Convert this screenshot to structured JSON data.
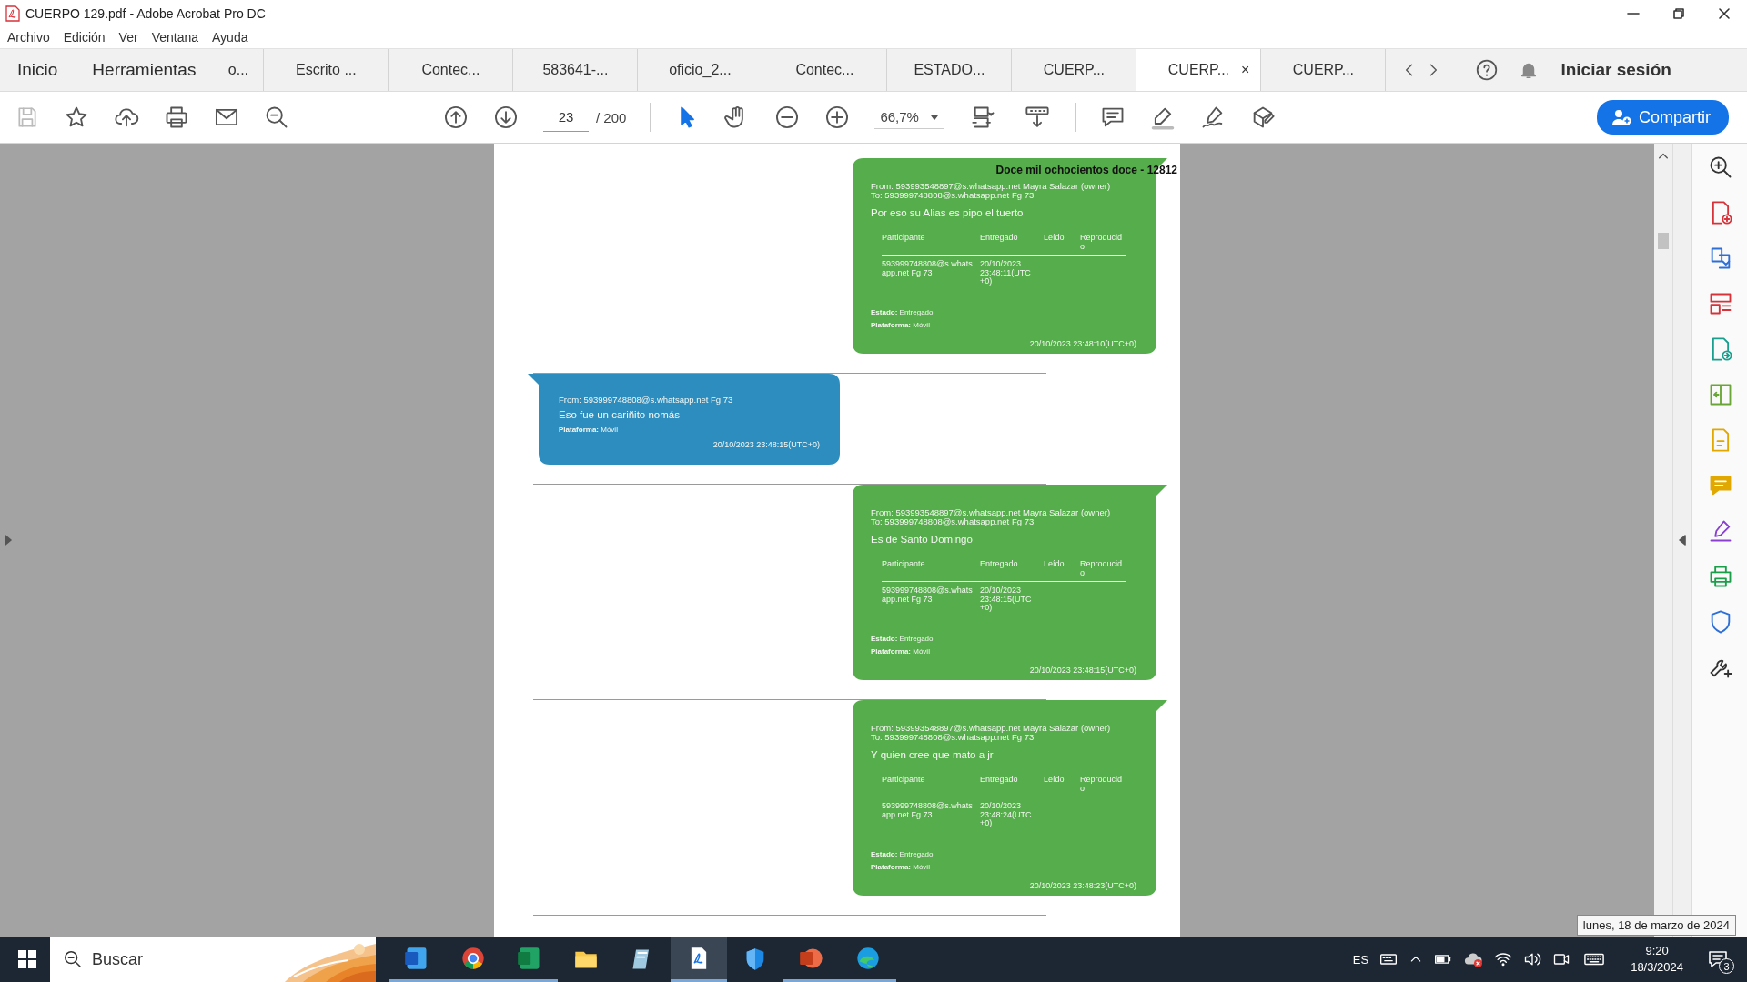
{
  "window": {
    "title": "CUERPO 129.pdf - Adobe Acrobat Pro DC"
  },
  "menu": [
    "Archivo",
    "Edición",
    "Ver",
    "Ventana",
    "Ayuda"
  ],
  "nav": [
    "Inicio",
    "Herramientas"
  ],
  "tabs": [
    {
      "label": "o...",
      "selected": false
    },
    {
      "label": "Escrito ...",
      "selected": false
    },
    {
      "label": "Contec...",
      "selected": false
    },
    {
      "label": "583641-...",
      "selected": false
    },
    {
      "label": "oficio_2...",
      "selected": false
    },
    {
      "label": "Contec...",
      "selected": false
    },
    {
      "label": "ESTADO...",
      "selected": false
    },
    {
      "label": "CUERP...",
      "selected": false
    },
    {
      "label": "CUERP...",
      "selected": true,
      "close": "×"
    },
    {
      "label": "CUERP...",
      "selected": false
    }
  ],
  "sign_in": "Iniciar sesión",
  "toolbar": {
    "page": "23",
    "pages": "/ 200",
    "zoom": "66,7%",
    "share": "Compartir"
  },
  "document": {
    "stamp": "Doce mil ochocientos doce - 12812",
    "messages": [
      {
        "kind": "outgoing",
        "from": "From: 593993548897@s.whatsapp.net Mayra Salazar (owner)",
        "to": "To: 593999748808@s.whatsapp.net Fg 73",
        "text": "Por eso su Alias es pipo el tuerto",
        "columns": [
          "Participante",
          "Entregado",
          "Leído",
          "Reproducido"
        ],
        "row": [
          "593999748808@s.whatsapp.net Fg 73",
          "20/10/2023 23:48:11(UTC +0)"
        ],
        "estado": "**Estado:** Entregado",
        "plataforma": "**Plataforma:** Móvil",
        "timestamp": "20/10/2023 23:48:10(UTC+0)"
      },
      {
        "kind": "incoming",
        "from": "From: 593999748808@s.whatsapp.net Fg 73",
        "text": "Eso fue un cariñito nomás",
        "plataforma": "**Plataforma:** Móvil",
        "timestamp": "20/10/2023 23:48:15(UTC+0)"
      },
      {
        "kind": "outgoing",
        "from": "From: 593993548897@s.whatsapp.net Mayra Salazar (owner)",
        "to": "To: 593999748808@s.whatsapp.net Fg 73",
        "text": "Es de Santo Domingo",
        "columns": [
          "Participante",
          "Entregado",
          "Leído",
          "Reproducido"
        ],
        "row": [
          "593999748808@s.whatsapp.net Fg 73",
          "20/10/2023 23:48:15(UTC +0)"
        ],
        "estado": "**Estado:** Entregado",
        "plataforma": "**Plataforma:** Móvil",
        "timestamp": "20/10/2023 23:48:15(UTC+0)"
      },
      {
        "kind": "outgoing",
        "from": "From: 593993548897@s.whatsapp.net Mayra Salazar (owner)",
        "to": "To: 593999748808@s.whatsapp.net Fg 73",
        "text": "Y quien cree que mato a jr",
        "columns": [
          "Participante",
          "Entregado",
          "Leído",
          "Reproducido"
        ],
        "row": [
          "593999748808@s.whatsapp.net Fg 73",
          "20/10/2023 23:48:24(UTC +0)"
        ],
        "estado": "**Estado:** Entregado",
        "plataforma": "**Plataforma:** Móvil",
        "timestamp": "20/10/2023 23:48:23(UTC+0)"
      }
    ]
  },
  "taskbar": {
    "search_placeholder": "Buscar",
    "language": "ES",
    "time": "9:20",
    "date": "18/3/2024",
    "notifications": "3",
    "tooltip": "lunes, 18 de marzo de 2024"
  }
}
